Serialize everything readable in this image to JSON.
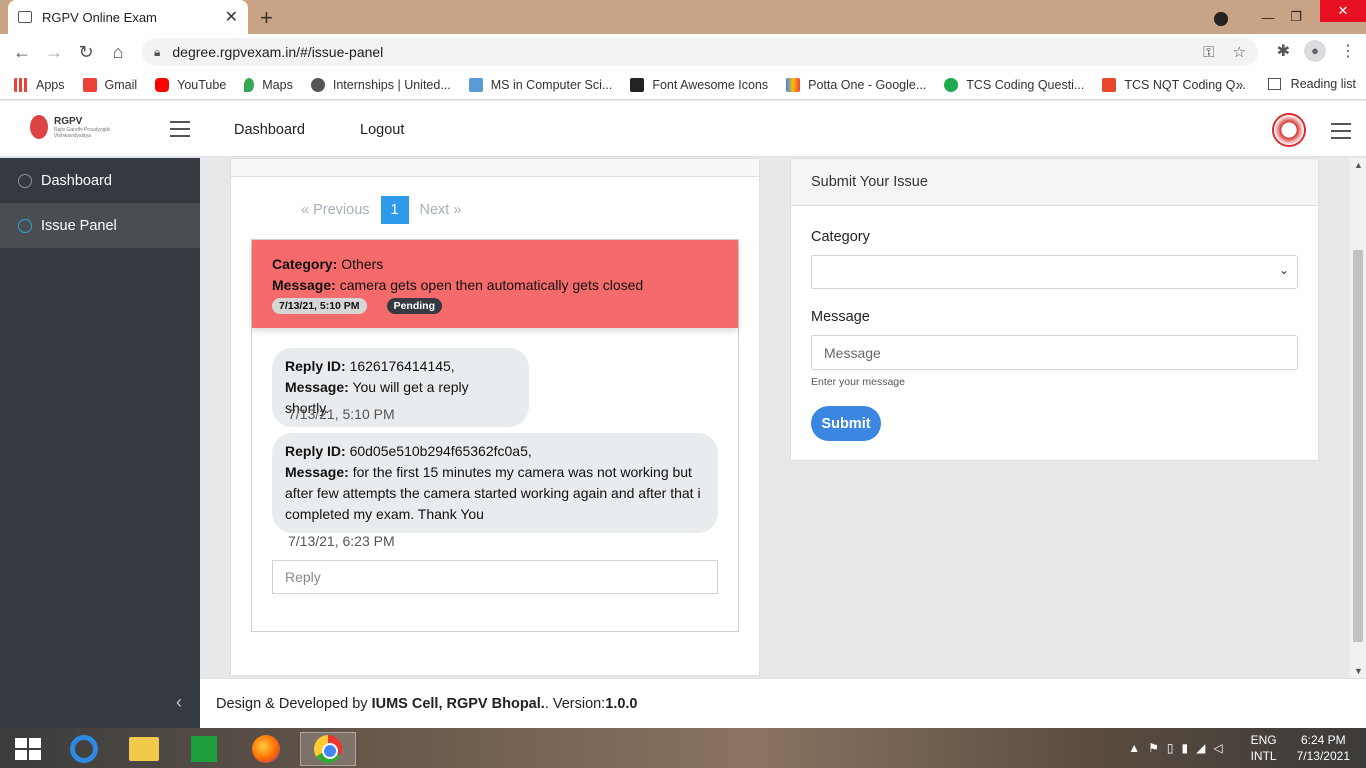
{
  "browser": {
    "tab_title": "RGPV Online Exam",
    "url": "degree.rgpvexam.in/#/issue-panel",
    "bookmarks": [
      {
        "label": "Apps",
        "color": "#e94235"
      },
      {
        "label": "Gmail",
        "color": "#ea4335"
      },
      {
        "label": "YouTube",
        "color": "#ff0000"
      },
      {
        "label": "Maps",
        "color": "#34a853"
      },
      {
        "label": "Internships | United...",
        "color": "#555555"
      },
      {
        "label": "MS in Computer Sci...",
        "color": "#5b9bd5"
      },
      {
        "label": "Font Awesome Icons",
        "color": "#222222"
      },
      {
        "label": "Potta One - Google...",
        "color": "#4285f4"
      },
      {
        "label": "TCS Coding Questi...",
        "color": "#1fa84f"
      },
      {
        "label": "TCS NQT Coding Q...",
        "color": "#e8472b"
      }
    ],
    "more": "»",
    "reading_list": "Reading list"
  },
  "header": {
    "logo_text": "RGPV",
    "logo_sub": "Rajiv Gandhi Proudyogiki Vishwavidyalaya",
    "nav": [
      "Dashboard",
      "Logout"
    ]
  },
  "sidebar": {
    "items": [
      {
        "label": "Dashboard",
        "active": false
      },
      {
        "label": "Issue Panel",
        "active": true
      }
    ],
    "collapse": "‹"
  },
  "pagination": {
    "prev": "«  Previous",
    "current": "1",
    "next": "Next  »"
  },
  "issue": {
    "category_label": "Category:",
    "category": "Others",
    "message_label": "Message:",
    "message": "camera gets open then automatically gets closed",
    "time": "7/13/21, 5:10 PM",
    "status": "Pending"
  },
  "replies": [
    {
      "id_label": "Reply ID:",
      "id": "1626176414145,",
      "message_label": "Message:",
      "message": "You will get a reply shortly.",
      "time": "7/13/21, 5:10 PM"
    },
    {
      "id_label": "Reply ID:",
      "id": "60d05e510b294f65362fc0a5,",
      "message_label": "Message:",
      "message": "for the first 15 minutes my camera was not working but after few attempts the camera started working again and after that i completed my exam. Thank You",
      "time": "7/13/21, 6:23 PM"
    }
  ],
  "reply_input": {
    "placeholder": "Reply"
  },
  "submit_form": {
    "title": "Submit Your Issue",
    "category_label": "Category",
    "category_value": "",
    "message_label": "Message",
    "message_placeholder": "Message",
    "hint": "Enter your message",
    "submit": "Submit"
  },
  "footer": {
    "prefix": "Design & Developed by ",
    "org": "IUMS Cell, RGPV Bhopal.",
    "version_label": ". Version: ",
    "version": "1.0.0"
  },
  "taskbar": {
    "lang_line1": "ENG",
    "lang_line2": "INTL",
    "time": "6:24 PM",
    "date": "7/13/2021"
  }
}
